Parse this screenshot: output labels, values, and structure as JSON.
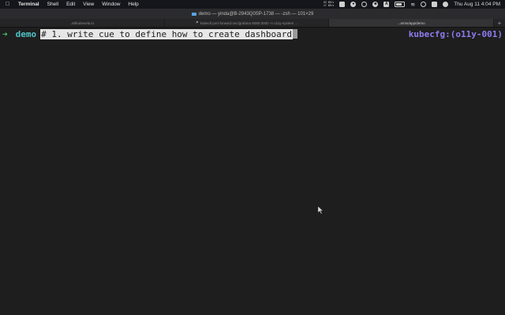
{
  "menubar": {
    "apple_icon": "apple-icon",
    "app_name": "Terminal",
    "menus": [
      "Shell",
      "Edit",
      "View",
      "Window",
      "Help"
    ],
    "net_up": "63 KB/s",
    "net_down": "17 KB/s",
    "clock": "Thu Aug 11  4:04 PM"
  },
  "window": {
    "title": "demo — yinda@B-2943Q0SP-1738 — -zsh — 101×29"
  },
  "tabs": [
    {
      "label": "..M/kubevela.io",
      "active": false
    },
    {
      "label": "kubectl port-forward svc/grafana 8080:3000 -n o11y-system ...",
      "active": false
    },
    {
      "label": "...arms/app/demo",
      "active": true
    }
  ],
  "terminal": {
    "prompt_arrow": "➜",
    "cwd": "demo",
    "command": "# 1. write cue to define how to create dashboard",
    "right_prompt": "kubecfg:(o11y-001)"
  },
  "colors": {
    "background": "#1e1e1e",
    "arrow": "#46c46a",
    "cwd": "#4fc3c7",
    "right_prompt": "#8e7cf0",
    "selection": "#e7e7e7"
  }
}
